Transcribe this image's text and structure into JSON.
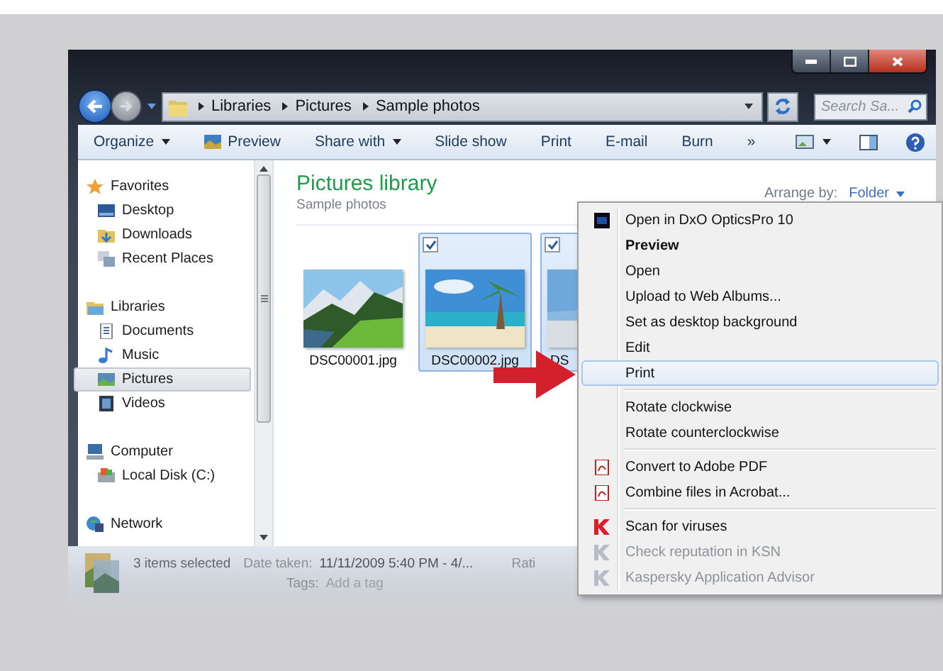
{
  "address": {
    "crumbs": [
      "Libraries",
      "Pictures",
      "Sample photos"
    ]
  },
  "search": {
    "placeholder": "Search Sa..."
  },
  "toolbar": [
    {
      "label": "Organize",
      "kind": "dropdown"
    },
    {
      "label": "Preview",
      "kind": "icon"
    },
    {
      "label": "Share with",
      "kind": "dropdown"
    },
    {
      "label": "Slide show",
      "kind": "plain"
    },
    {
      "label": "Print",
      "kind": "plain"
    },
    {
      "label": "E-mail",
      "kind": "plain"
    },
    {
      "label": "Burn",
      "kind": "plain"
    },
    {
      "label": "»",
      "kind": "plain"
    }
  ],
  "nav": [
    {
      "label": "Favorites",
      "selected": false,
      "children": [
        {
          "label": "Desktop",
          "selected": false
        },
        {
          "label": "Downloads",
          "selected": false
        },
        {
          "label": "Recent Places",
          "selected": false
        }
      ]
    },
    {
      "label": "Libraries",
      "selected": false,
      "children": [
        {
          "label": "Documents",
          "selected": false
        },
        {
          "label": "Music",
          "selected": false
        },
        {
          "label": "Pictures",
          "selected": true
        },
        {
          "label": "Videos",
          "selected": false
        }
      ]
    },
    {
      "label": "Computer",
      "selected": false,
      "children": [
        {
          "label": "Local Disk (C:)",
          "selected": false
        }
      ]
    },
    {
      "label": "Network",
      "selected": false
    }
  ],
  "library": {
    "title": "Pictures library",
    "subtitle": "Sample photos",
    "arrange_label": "Arrange by:",
    "arrange_value": "Folder"
  },
  "files": [
    {
      "name": "DSC00001.jpg",
      "selected": false,
      "checked": false
    },
    {
      "name": "DSC00002.jpg",
      "selected": true,
      "checked": true
    },
    {
      "name": "DS",
      "selected": true,
      "checked": true
    }
  ],
  "details": {
    "count": "3 items selected",
    "date_label": "Date taken:",
    "date_value": "11/11/2009 5:40 PM - 4/...",
    "tags_label": "Tags:",
    "tags_value": "Add a tag",
    "rating_label": "Rati"
  },
  "context_menu": [
    {
      "items": [
        {
          "label": "Open in DxO OpticsPro 10",
          "icon": true,
          "bold": false,
          "disabled": false,
          "selected": false
        },
        {
          "label": "Preview",
          "icon": false,
          "bold": true,
          "disabled": false,
          "selected": false
        },
        {
          "label": "Open",
          "icon": false,
          "bold": false,
          "disabled": false,
          "selected": false
        },
        {
          "label": "Upload to Web Albums...",
          "icon": false,
          "bold": false,
          "disabled": false,
          "selected": false
        },
        {
          "label": "Set as desktop background",
          "icon": false,
          "bold": false,
          "disabled": false,
          "selected": false
        },
        {
          "label": "Edit",
          "icon": false,
          "bold": false,
          "disabled": false,
          "selected": false
        },
        {
          "label": "Print",
          "icon": false,
          "bold": false,
          "disabled": false,
          "selected": true
        }
      ]
    },
    {
      "items": [
        {
          "label": "Rotate clockwise",
          "icon": false,
          "bold": false,
          "disabled": false,
          "selected": false
        },
        {
          "label": "Rotate counterclockwise",
          "icon": false,
          "bold": false,
          "disabled": false,
          "selected": false
        }
      ]
    },
    {
      "items": [
        {
          "label": "Convert to Adobe PDF",
          "icon": true,
          "bold": false,
          "disabled": false,
          "selected": false
        },
        {
          "label": "Combine files in Acrobat...",
          "icon": true,
          "bold": false,
          "disabled": false,
          "selected": false
        }
      ]
    },
    {
      "items": [
        {
          "label": "Scan for viruses",
          "icon": true,
          "bold": false,
          "disabled": false,
          "selected": false
        },
        {
          "label": "Check reputation in KSN",
          "icon": true,
          "bold": false,
          "disabled": true,
          "selected": false
        },
        {
          "label": "Kaspersky Application Advisor",
          "icon": true,
          "bold": false,
          "disabled": true,
          "selected": false
        }
      ]
    }
  ]
}
